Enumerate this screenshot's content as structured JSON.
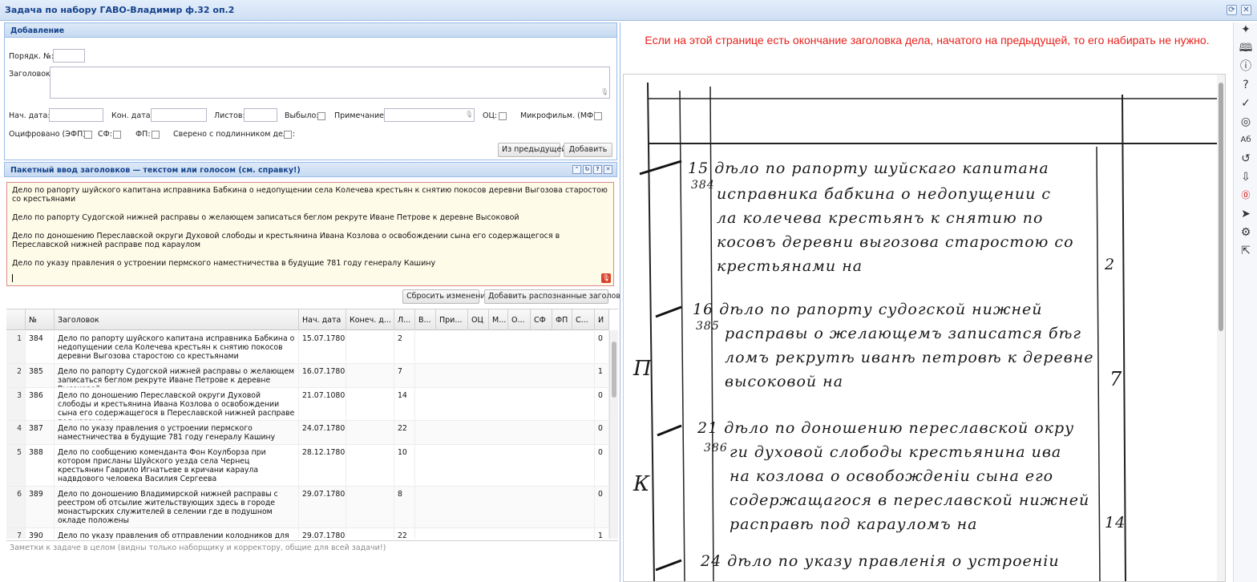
{
  "window": {
    "title": "Задача по набору ГАВО-Владимир ф.32 оп.2"
  },
  "add_panel": {
    "title": "Добавление",
    "order_label": "Порядк. №:",
    "heading_label": "Заголовок:",
    "start_date_label": "Нач. дата:",
    "end_date_label": "Кон. дата:",
    "sheets_label": "Листов:",
    "dropped_label": "Выбыло:",
    "note_label": "Примечание:",
    "oc_label": "ОЦ:",
    "microfilm_label": "Микрофильм. (МФ):",
    "digitized_label": "Оцифровано (ЭФП):",
    "sf_label": "СФ:",
    "fp_label": "ФП:",
    "verified_label": "Сверено с подлинником дела:",
    "from_prev_button": "Из предыдущей",
    "add_button": "Добавить"
  },
  "batch_panel": {
    "title": "Пакетный ввод заголовков — текстом или голосом (см. справку!)",
    "lines": [
      "Дело по рапорту шуйского капитана исправника Бабкина о недопущении села Колечева крестьян к снятию покосов деревни Выгозова старостою со крестьянами",
      "Дело по рапорту Судогской нижней расправы о желающем записаться беглом рекруте Иване Петрове к деревне Высоковой",
      "Дело по доношению Переславской округи Духовой слободы и крестьянина Ивана Козлова о освобождении сына его содержащегося в Переславской нижней расправе под караулом",
      "Дело по указу правления о устроении пермского наместничества в будущие 781 году генералу Кашину"
    ],
    "reset_button": "Сбросить изменения",
    "add_recognized_button": "Добавить распознанные заголовки"
  },
  "grid": {
    "columns": [
      "№",
      "Заголовок",
      "Нач. дата",
      "Конеч. д...",
      "Л...",
      "В...",
      "При...",
      "ОЦ",
      "М...",
      "О...",
      "СФ",
      "ФП",
      "С...",
      "И"
    ],
    "rows": [
      {
        "rownum": "1",
        "num": "384",
        "title": "Дело по рапорту шуйского капитана исправника Бабкина о недопущении села Колечева крестьян к снятию покосов деревни Выгозова старостою со крестьянами",
        "start": "15.07.1780",
        "sheets": "2",
        "last": "0"
      },
      {
        "rownum": "2",
        "num": "385",
        "title": "Дело по рапорту Судогской нижней расправы о желающем записаться беглом рекруте Иване Петрове к деревне Высоковой",
        "start": "16.07.1780",
        "sheets": "7",
        "last": "1"
      },
      {
        "rownum": "3",
        "num": "386",
        "title": "Дело по доношению Переславской округи Духовой слободы и крестьянина Ивана Козлова о освобождении сына его содержащегося в Переславской нижней расправе под караулом",
        "start": "21.07.1080",
        "sheets": "14",
        "last": "0"
      },
      {
        "rownum": "4",
        "num": "387",
        "title": "Дело по указу правления о устроении пермского наместничества в будущие 781 году генералу Кашину",
        "start": "24.07.1780",
        "sheets": "22",
        "last": "0"
      },
      {
        "rownum": "5",
        "num": "388",
        "title": "Дело по сообщению коменданта Фон Коулборза при котором присланы Шуйского уезда села Чернец крестьянин Гаврило Игнатьеве в кричани караула надвдового человека Василия Сергеева",
        "start": "28.12.1780",
        "sheets": "10",
        "last": "0"
      },
      {
        "rownum": "6",
        "num": "389",
        "title": "Дело по доношению Владимирской нижней расправы с реестром об отсылие жительствующих здесь в городе монастырских служителей в селении где в подушном окладе положены",
        "start": "29.07.1780",
        "sheets": "8",
        "last": "0"
      },
      {
        "rownum": "7",
        "num": "390",
        "title": "Дело по указу правления об отправлении колодников для",
        "start": "29.07.1780",
        "sheets": "22",
        "last": "1"
      }
    ]
  },
  "notes_placeholder": "Заметки к задаче в целом (видны только наборщику и корректору, общие для всей задачи!)",
  "right": {
    "warning": "Если на этой странице есть окончание заголовка дела, начатого на предыдущей, то его набирать не нужно."
  },
  "toolbar_icons": [
    "sparkle-icon",
    "book-icon",
    "info-icon",
    "help-icon",
    "check-circle-icon",
    "globe-icon",
    "translate-icon",
    "rotate-icon",
    "download-icon",
    "zero-badge-icon",
    "send-icon",
    "settings-icon",
    "export-icon"
  ]
}
